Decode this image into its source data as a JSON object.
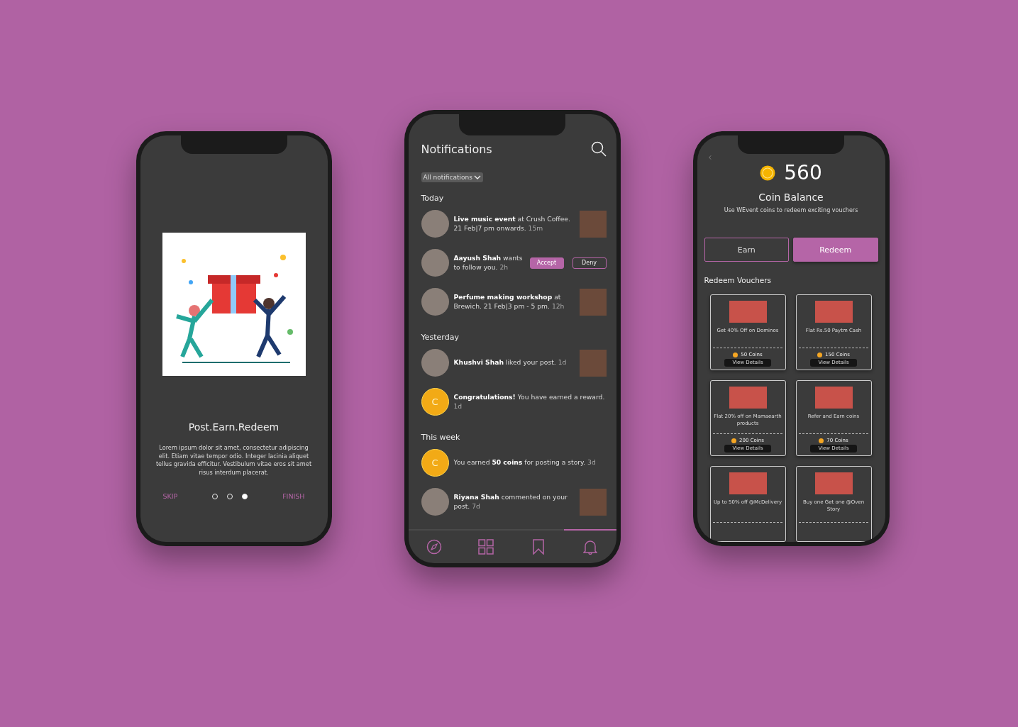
{
  "onboarding": {
    "title": "Post.Earn.Redeem",
    "body": "Lorem ipsum dolor sit amet, consectetur adipiscing elit. Etiam vitae tempor odio. Integer lacinia aliquet tellus gravida efficitur. Vestibulum vitae eros sit amet risus interdum placerat.",
    "skip": "SKIP",
    "finish": "FINISH",
    "dots": [
      {
        "selected": false
      },
      {
        "selected": false
      },
      {
        "selected": true
      }
    ]
  },
  "notifications": {
    "title": "Notifications",
    "filter": "All notifications",
    "sections": [
      {
        "heading": "Today",
        "items": [
          {
            "kind": "avatar",
            "text": "**Live music event** at Crush Coffee. 21 Feb|7 pm onwards.",
            "time": "15m",
            "thumbnail": true
          },
          {
            "kind": "request",
            "text": "**Aayush Shah** wants to follow you.",
            "time": "2h",
            "thumbnail": false,
            "accept": "Accept",
            "deny": "Deny"
          },
          {
            "kind": "avatar",
            "text": "**Perfume making workshop** at Brewich. 21 Feb|3 pm - 5 pm.",
            "time": "12h",
            "thumbnail": true
          }
        ]
      },
      {
        "heading": "Yesterday",
        "items": [
          {
            "kind": "avatar",
            "text": "**Khushvi Shah** liked your post.",
            "time": "1d",
            "thumbnail": true
          },
          {
            "kind": "coin",
            "badge": "C",
            "text": "**Congratulations!** You have earned a reward.",
            "time": "1d",
            "thumbnail": false
          }
        ]
      },
      {
        "heading": "This week",
        "items": [
          {
            "kind": "coin",
            "badge": "C",
            "text": "You earned **50 coins** for posting a story.",
            "time": "3d",
            "thumbnail": false
          },
          {
            "kind": "avatar",
            "text": "**Riyana Shah** commented on your post.",
            "time": "7d",
            "thumbnail": true
          }
        ]
      }
    ],
    "nav": [
      {
        "kind": "compass",
        "selected": false
      },
      {
        "kind": "grid",
        "selected": false
      },
      {
        "kind": "bookmark",
        "selected": false
      },
      {
        "kind": "bell",
        "selected": true
      }
    ]
  },
  "coins": {
    "balance": "560",
    "label": "Coin Balance",
    "subtitle": "Use WEvent coins to redeem exciting vouchers",
    "tabs": [
      {
        "label": "Earn",
        "selected": false
      },
      {
        "label": "Redeem",
        "selected": true
      }
    ],
    "heading": "Redeem Vouchers",
    "vouchers": [
      {
        "title": "Get 40% Off on Dominos",
        "coins": "50 Coins",
        "details": "View Details"
      },
      {
        "title": "Flat Rs.50 Paytm Cash",
        "coins": "150 Coins",
        "details": "View Details"
      },
      {
        "title": "Flat 20% off on Mamaearth products",
        "coins": "200 Coins",
        "details": "View Details"
      },
      {
        "title": "Refer and Earn coins",
        "coins": "70 Coins",
        "details": "View Details"
      },
      {
        "title": "Up to 50% off @McDelivery"
      },
      {
        "title": "Buy one Get one @Oven Story"
      }
    ]
  }
}
